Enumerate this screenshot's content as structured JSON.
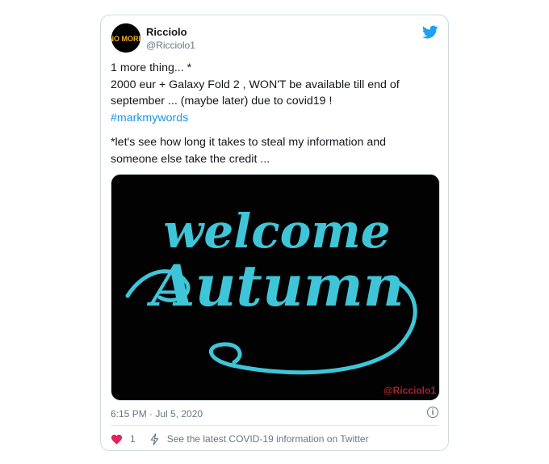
{
  "tweet": {
    "display_name": "Ricciolo",
    "handle": "@Ricciolo1",
    "avatar_text": "NO MORE",
    "lines": [
      "1 more thing... *",
      "2000 eur + Galaxy Fold 2 , WON'T be available till end of",
      "september ... (maybe later) due to covid19 !"
    ],
    "hashtag": "#markmywords",
    "lines2": [
      "*let's see how long it takes to steal my information and",
      "someone else take the credit ..."
    ],
    "media": {
      "text_line1": "welcome",
      "text_line2": "Autumn",
      "watermark": "@Ricciolo1",
      "text_color": "#3fc5d8"
    },
    "timestamp": "6:15 PM · Jul 5, 2020",
    "like_count": "1",
    "covid_link": "See the latest COVID-19 information on Twitter",
    "colors": {
      "link": "#1b95e0",
      "twitter_blue": "#1da1f2",
      "muted": "#657786",
      "like": "#e0245e"
    }
  }
}
